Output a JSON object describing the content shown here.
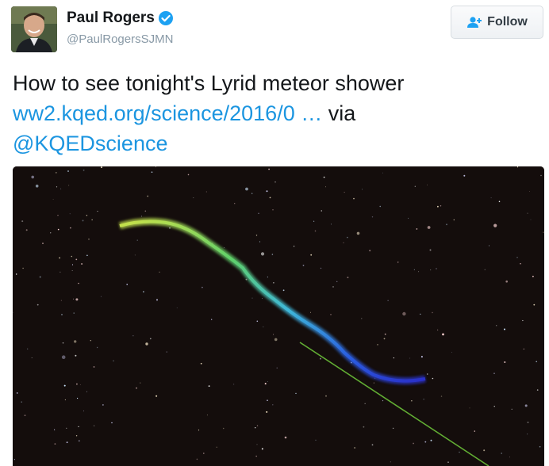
{
  "user": {
    "display_name": "Paul Rogers",
    "handle": "@PaulRogersSJMN",
    "verified": true
  },
  "follow_button": {
    "label": "Follow"
  },
  "tweet": {
    "text_prefix": "How to see tonight's Lyrid meteor shower ",
    "link_text": "ww2.kqed.org/science/2016/0",
    "link_ellipsis": " …",
    "text_via": " via ",
    "mention": "@KQEDscience"
  },
  "colors": {
    "link": "#1b95e0",
    "verified_badge": "#1da1f2",
    "text": "#14171a",
    "handle": "#8899a6"
  }
}
